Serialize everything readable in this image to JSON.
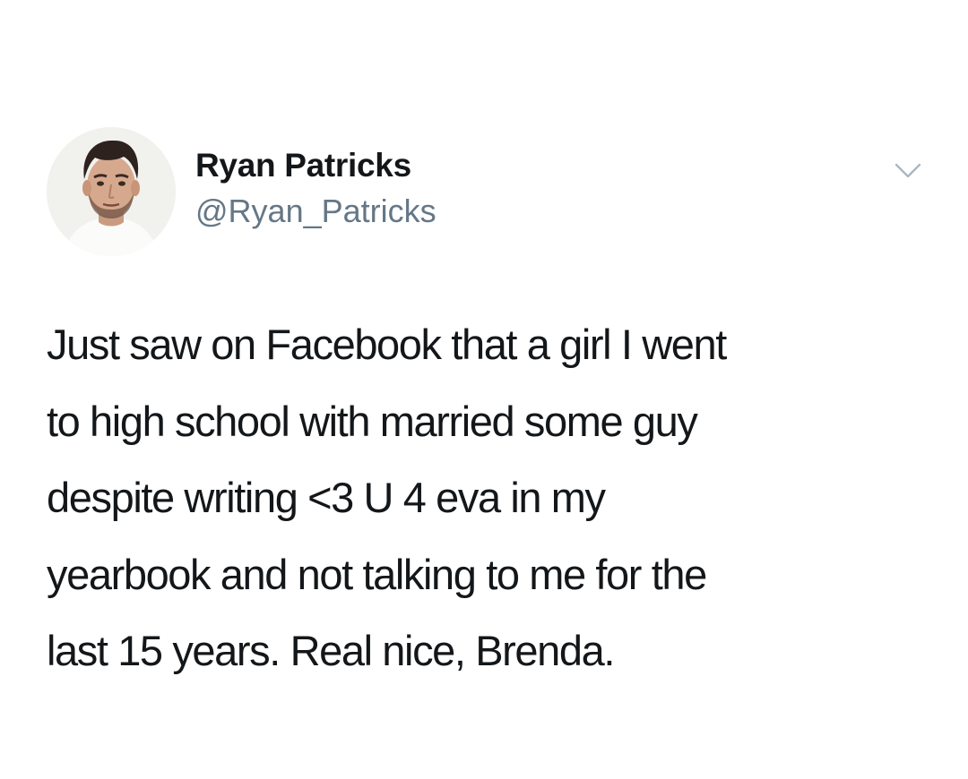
{
  "tweet": {
    "author": {
      "display_name": "Ryan Patricks",
      "handle": "@Ryan_Patricks",
      "avatar_icon": "profile-photo"
    },
    "menu_icon": "chevron-down-icon",
    "text": "Just saw on Facebook that a girl I went\nto high school with married some guy\ndespite writing <3 U 4 eva in my\nyearbook and not talking to me for the\nlast 15 years. Real nice, Brenda."
  },
  "colors": {
    "background": "#ffffff",
    "text": "#14171a",
    "handle": "#657786",
    "chevron": "#aab8c2"
  }
}
